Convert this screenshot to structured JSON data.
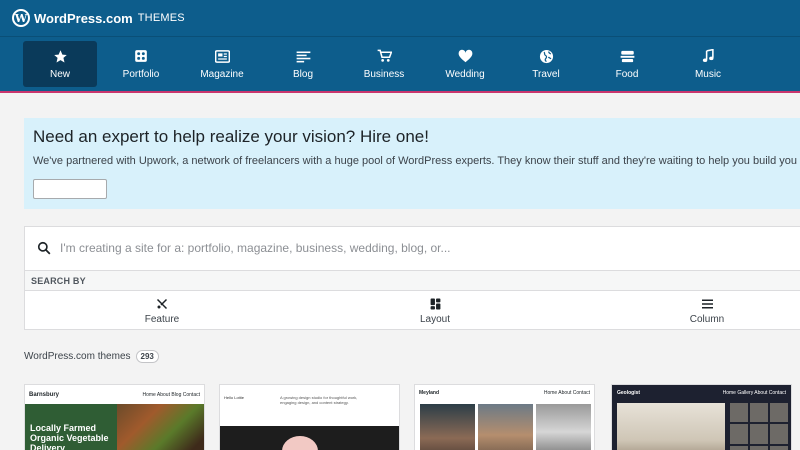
{
  "header": {
    "brand": "WordPress.com",
    "section": "THEMES"
  },
  "categories": [
    {
      "label": "New",
      "icon": "star-icon",
      "active": true
    },
    {
      "label": "Portfolio",
      "icon": "portfolio-icon"
    },
    {
      "label": "Magazine",
      "icon": "magazine-icon"
    },
    {
      "label": "Blog",
      "icon": "blog-icon"
    },
    {
      "label": "Business",
      "icon": "cart-icon"
    },
    {
      "label": "Wedding",
      "icon": "heart-icon"
    },
    {
      "label": "Travel",
      "icon": "globe-icon"
    },
    {
      "label": "Food",
      "icon": "food-icon"
    },
    {
      "label": "Music",
      "icon": "music-icon"
    }
  ],
  "banner": {
    "title": "Need an expert to help realize your vision? Hire one!",
    "text": "We've partnered with Upwork, a network of freelancers with a huge pool of WordPress experts. They know their stuff and they're waiting to help you build you"
  },
  "search": {
    "placeholder": "I'm creating a site for a: portfolio, magazine, business, wedding, blog, or...",
    "search_by_label": "SEARCH BY",
    "filters": [
      "Feature",
      "Layout",
      "Column"
    ]
  },
  "themes": {
    "heading": "WordPress.com themes",
    "count": "293",
    "cards": [
      {
        "name": "Barnsbury",
        "tagline": "Locally Farmed Organic Vegetable Delivery",
        "nav": "Home  About  Blog  Contact"
      },
      {
        "name": "Hello Lottie",
        "text": "A growing design studio for thoughtful work, engaging design, and content strategy."
      },
      {
        "name": "Meyland",
        "nav": "Home  About  Contact"
      },
      {
        "name": "Geologist",
        "nav": "Home  Gallery  About  Contact"
      }
    ]
  }
}
